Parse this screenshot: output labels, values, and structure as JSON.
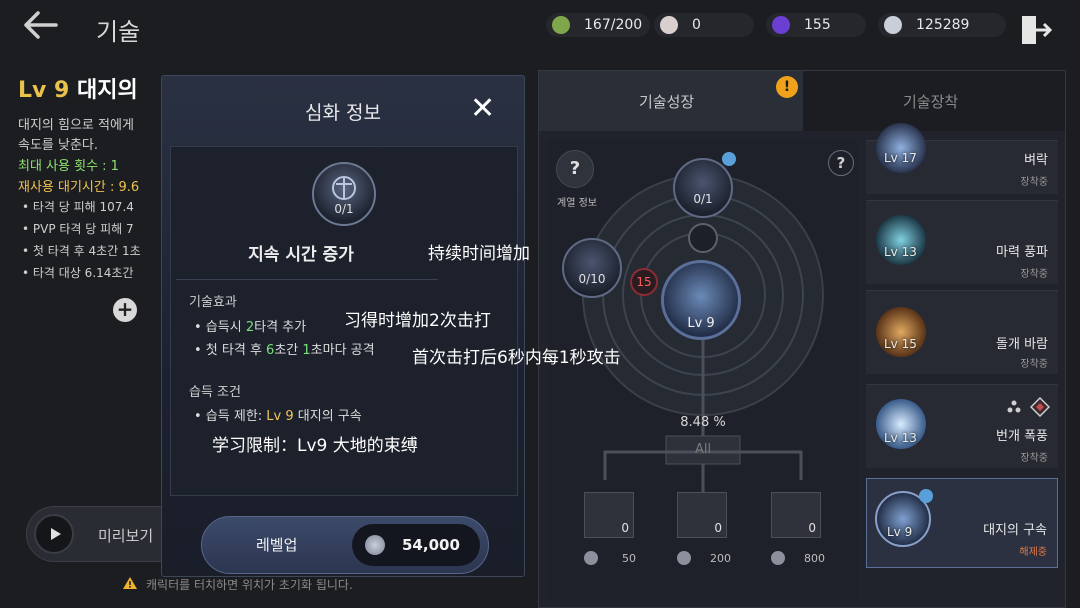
{
  "header": {
    "title": "기술",
    "currencies": [
      {
        "icon": "stamina-icon",
        "value": "167/200",
        "color": "#7fa64a"
      },
      {
        "icon": "pearl-icon",
        "value": "0",
        "color": "#d9cfcf"
      },
      {
        "icon": "orb-icon",
        "value": "155",
        "color": "#6b3fd1"
      },
      {
        "icon": "silver-coin-icon",
        "value": "125289",
        "color": "#c9ced8"
      }
    ]
  },
  "left": {
    "skill_level": "Lv 9",
    "skill_name": "대지의",
    "desc1": "대지의 힘으로 적에게",
    "desc2": "속도를 낮춘다.",
    "max_use": "최대 사용 횟수 : 1",
    "cooldown": "재사용 대기시간 : 9.6",
    "bullets": [
      "• 타격 당 피해 107.4",
      "• PVP 타격 당 피해 7",
      "• 첫 타격 후 4초간 1초",
      "• 타격 대상 6.14초간"
    ],
    "preview_label": "미리보기",
    "hint": "캐릭터를 터치하면 위치가 초기화 됩니다."
  },
  "modal": {
    "title": "심화 정보",
    "close": "✕",
    "node_count": "0/1",
    "node_name": "지속 시간 증가",
    "overlay_name_cn": "持续时间增加",
    "effect_title": "기술효과",
    "effect1_pre": "• 습득시 ",
    "effect1_hl": "2",
    "effect1_post": "타격 추가",
    "effect1_cn": "习得时增加2次击打",
    "effect2_pre": "• 첫 타격 후 ",
    "effect2_hl1": "6",
    "effect2_mid": "초간 ",
    "effect2_hl2": "1",
    "effect2_post": "초마다 공격",
    "effect2_cn": "首次击打后6秒内每1秒攻击",
    "cond_title": "습득 조건",
    "cond_pre": "• 습득 제한: ",
    "cond_hl": "Lv 9",
    "cond_post": " 대지의 구속",
    "cond_cn": "学习限制：Lv9 大地的束缚",
    "levelup_label": "레벨업",
    "cost": "54,000"
  },
  "right": {
    "tab_growth": "기술성장",
    "tab_equip": "기술장착",
    "alert": "!",
    "info_label": "계열 정보",
    "help": "?",
    "tree": {
      "top_node": "0/1",
      "left_node": "0/10",
      "center_level": "Lv 9",
      "red_badge": "15",
      "percent": "8.48 %",
      "all_button": "All",
      "sub_nodes": [
        {
          "count": "0",
          "cost": "50"
        },
        {
          "count": "0",
          "cost": "200"
        },
        {
          "count": "0",
          "cost": "800"
        }
      ]
    },
    "skills": [
      {
        "level": "Lv 17",
        "name": "벼락",
        "state": "장착중",
        "color": "#4a6a9a"
      },
      {
        "level": "Lv 13",
        "name": "마력 풍파",
        "state": "장착중",
        "color": "#3b8aa8"
      },
      {
        "level": "Lv 15",
        "name": "돌개 바람",
        "state": "장착중",
        "color": "#b07a3a"
      },
      {
        "level": "Lv 13",
        "name": "번개 폭풍",
        "state": "장착중",
        "color": "#7aa6d8"
      },
      {
        "level": "Lv 9",
        "name": "대지의 구속",
        "state": "해제중",
        "color": "#4c6a96"
      }
    ]
  }
}
